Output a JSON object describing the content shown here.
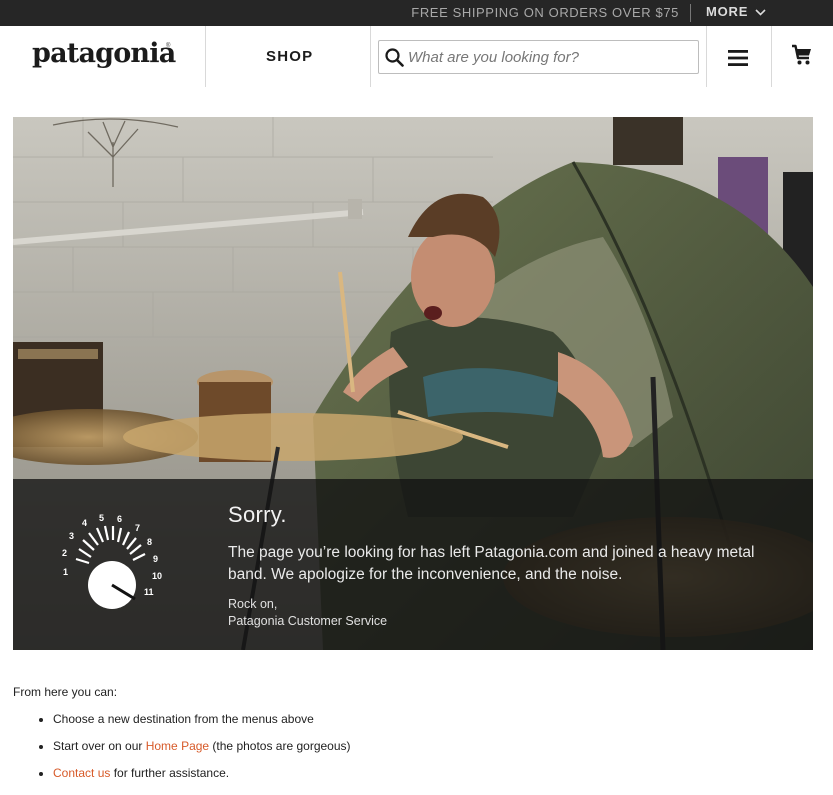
{
  "promo": {
    "shipping_text": "FREE SHIPPING ON ORDERS OVER $75",
    "more_label": "MORE"
  },
  "header": {
    "logo_text": "patagonia",
    "logo_mark": "®",
    "shop_label": "SHOP",
    "search_placeholder": "What are you looking for?",
    "search_value": "",
    "icons": [
      "search-icon",
      "hamburger-menu-icon",
      "shopping-cart-icon",
      "chevron-down-icon"
    ]
  },
  "hero": {
    "image_alt": "drummer-playing-in-front-of-tent",
    "heading": "Sorry.",
    "message": "The page you’re looking for has left Patagonia.com and joined a heavy metal band. We apologize for the inconvenience, and the noise.",
    "signoff_line1": "Rock on,",
    "signoff_line2": "Patagonia Customer Service",
    "knob_numbers": [
      "1",
      "2",
      "3",
      "4",
      "5",
      "6",
      "7",
      "8",
      "9",
      "10",
      "11"
    ]
  },
  "help": {
    "intro": "From here you can:",
    "item1_text": "Choose a new destination from the menus above",
    "item2_prefix": "Start over on our ",
    "item2_link": "Home Page",
    "item2_suffix": " (the photos are gorgeous)",
    "item3_link": "Contact us",
    "item3_suffix": " for further assistance."
  },
  "colors": {
    "promo_bg": "#262626",
    "link": "#d75a29",
    "overlay": "#121212"
  }
}
